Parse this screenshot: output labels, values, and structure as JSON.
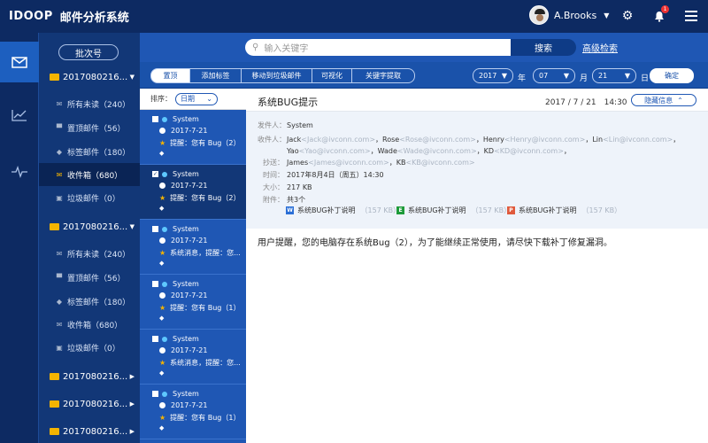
{
  "app": {
    "brand": "IDOOP",
    "title": "邮件分析系统"
  },
  "user": {
    "name": "A.Brooks",
    "notifications": "1"
  },
  "icons": {
    "settings": "gear-icon",
    "bell": "bell-icon",
    "menu": "hamburger-icon"
  },
  "rail": [
    {
      "name": "mail",
      "icon": "✉"
    },
    {
      "name": "trend",
      "icon": "📈"
    },
    {
      "name": "pulse",
      "icon": "〰"
    }
  ],
  "sidebar": {
    "batch_button": "批次号",
    "groups": [
      {
        "label": "2017080216...",
        "expanded": true,
        "items": [
          {
            "label": "所有未读（240）"
          },
          {
            "label": "置顶邮件（56）"
          },
          {
            "label": "标签邮件（180）"
          },
          {
            "label": "收件箱（680）",
            "active": true
          },
          {
            "label": "垃圾邮件（0）"
          }
        ]
      },
      {
        "label": "2017080216...",
        "expanded": true,
        "items": [
          {
            "label": "所有未读（240）"
          },
          {
            "label": "置顶邮件（56）"
          },
          {
            "label": "标签邮件（180）"
          },
          {
            "label": "收件箱（680）"
          },
          {
            "label": "垃圾邮件（0）"
          }
        ]
      },
      {
        "label": "2017080216...",
        "expanded": false
      },
      {
        "label": "2017080216...",
        "expanded": false
      },
      {
        "label": "2017080216...",
        "expanded": false
      }
    ]
  },
  "search": {
    "placeholder": "输入关键字",
    "button": "搜索",
    "advanced": "高级检索"
  },
  "toolbar": {
    "buttons": [
      "置顶",
      "添加标签",
      "移动到垃圾邮件",
      "可视化",
      "关键字提取"
    ],
    "year": "2017",
    "year_unit": "年",
    "month": "07",
    "month_unit": "月",
    "day": "21",
    "day_unit": "日",
    "confirm": "确定"
  },
  "list": {
    "sort_label": "排序：",
    "sort_value": "日期",
    "items": [
      {
        "sender": "System",
        "date": "2017-7-21",
        "summary": "提醒：您有 Bug（2）",
        "checked": false
      },
      {
        "sender": "System",
        "date": "2017-7-21",
        "summary": "提醒：您有 Bug（2）",
        "checked": true
      },
      {
        "sender": "System",
        "date": "2017-7-21",
        "summary": "系统消息，提醒：您...",
        "checked": false
      },
      {
        "sender": "System",
        "date": "2017-7-21",
        "summary": "提醒：您有 Bug（1）",
        "checked": false
      },
      {
        "sender": "System",
        "date": "2017-7-21",
        "summary": "系统消息，提醒：您...",
        "checked": false
      },
      {
        "sender": "System",
        "date": "2017-7-21",
        "summary": "提醒：您有 Bug（1）",
        "checked": false
      }
    ]
  },
  "message": {
    "subject": "系统BUG提示",
    "date": "2017 / 7 / 21　14:30",
    "hide_info": "隐藏信息",
    "from_label": "发件人：",
    "from": "System",
    "to_label": "收件人：",
    "to_line1": [
      {
        "name": "Jack",
        "email": "<Jack@ivconn.com>"
      },
      {
        "name": "Rose",
        "email": "<Rose@ivconn.com>"
      },
      {
        "name": "Henry",
        "email": "<Henry@ivconn.com>"
      },
      {
        "name": "Lin",
        "email": "<Lin@ivconn.com>"
      }
    ],
    "to_line2": [
      {
        "name": "Yao",
        "email": "<Yao@ivconn.com>"
      },
      {
        "name": "Wade",
        "email": "<Wade@ivconn.com>"
      },
      {
        "name": "KD",
        "email": "<KD@ivconn.com>"
      }
    ],
    "cc_label": "抄送：",
    "cc": [
      {
        "name": "James",
        "email": "<James@ivconn.com>"
      },
      {
        "name": "KB",
        "email": "<KB@ivconn.com>"
      }
    ],
    "time_label": "时间：",
    "time": "2017年8月4日（周五）14:30",
    "size_label": "大小：",
    "size": "217 KB",
    "attach_label": "附件：",
    "attach_count": "共3个",
    "attachments": [
      {
        "type": "W",
        "color": "#2b6fd6",
        "name": "系统BUG补丁说明",
        "size": "（157 KB）"
      },
      {
        "type": "E",
        "color": "#1e9b3a",
        "name": "系统BUG补丁说明",
        "size": "（157 KB）"
      },
      {
        "type": "P",
        "color": "#e05a3c",
        "name": "系统BUG补丁说明",
        "size": "（157 KB）"
      }
    ],
    "body": "用户提醒，您的电脑存在系统Bug（2），为了能继续正常使用，请尽快下载补丁修复漏洞。"
  }
}
